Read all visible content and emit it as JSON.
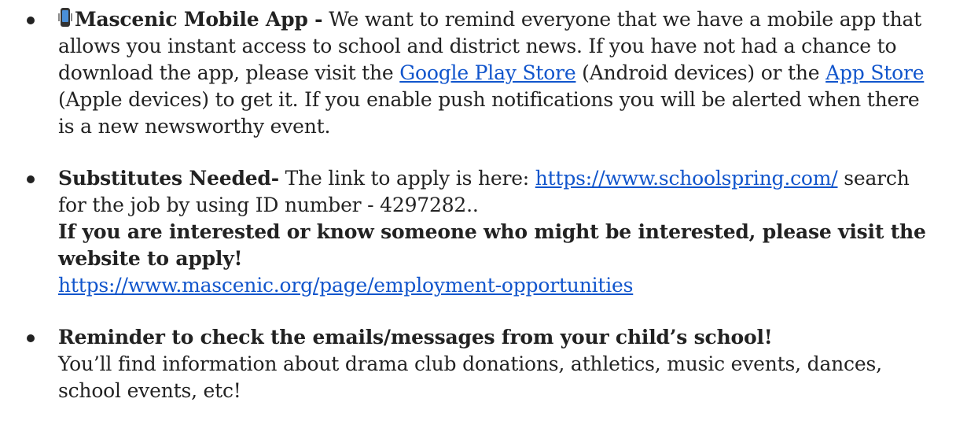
{
  "items": [
    {
      "title": "Mascenic Mobile App -",
      "text_before_link1": " We want to remind everyone that we have a mobile app that allows you instant access to school and district news. If you have not had a chance to download the app, please visit the ",
      "link1": "Google Play Store",
      "text_between": " (Android devices) or the ",
      "link2": "App Store",
      "text_after": " (Apple devices) to get it. If you enable push notifications you will be alerted when there is a new newsworthy event."
    },
    {
      "title": "Substitutes Needed-",
      "text_before_link": " The link to apply is here: ",
      "link1": "https://www.schoolspring.com/",
      "text_after_link": " search for the job by using ID number - 4297282..",
      "bold_line": "If you are interested or know someone who might be interested, please visit the website to apply!",
      "link2": "https://www.mascenic.org/page/employment-opportunities"
    },
    {
      "title": "Reminder to check the emails/messages from your child’s school!",
      "text": "You’ll find information about drama club donations, athletics, music events, dances, school events, etc!"
    }
  ],
  "icons": {
    "mobile_app": "vibrating-phone-icon"
  }
}
